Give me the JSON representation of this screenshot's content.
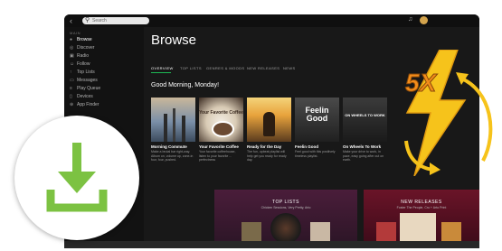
{
  "topbar": {
    "back_icon": "chevron-left-icon",
    "search_placeholder": "Search"
  },
  "sidebar": {
    "heading": "MAIN",
    "items": [
      {
        "label": "Browse",
        "icon": "browse-icon"
      },
      {
        "label": "Discover",
        "icon": "discover-icon"
      },
      {
        "label": "Radio",
        "icon": "radio-icon"
      },
      {
        "label": "Follow",
        "icon": "follow-icon"
      },
      {
        "label": "Top Lists",
        "icon": "top-lists-icon"
      },
      {
        "label": "Messages",
        "icon": "messages-icon"
      },
      {
        "label": "Play Queue",
        "icon": "play-queue-icon"
      },
      {
        "label": "Devices",
        "icon": "devices-icon"
      },
      {
        "label": "App Finder",
        "icon": "app-finder-icon"
      }
    ]
  },
  "main": {
    "title": "Browse",
    "tabs": [
      "OVERVIEW",
      "TOP LISTS",
      "GENRES & MOODS",
      "NEW RELEASES",
      "NEWS"
    ],
    "greeting": "Good Morning, Monday!",
    "cards": [
      {
        "title": "Morning Commute",
        "desc": "Make a brutal bar right-way. Album on, volume up, zone-in four, four, pushed.",
        "art_text": ""
      },
      {
        "title": "Your Favorite Coffee",
        "desc": "Your favorite coffeehouse, listen to your favorite ... perfectness",
        "art_text": "Your Favorite Coffee"
      },
      {
        "title": "Ready for the Day",
        "desc": "The fun, upbeat playlist will help get you ready for ready day.",
        "art_text": ""
      },
      {
        "title": "Feelin Good",
        "desc": "Feel good with this positively timeless playlist.",
        "art_text": "Feelin Good"
      },
      {
        "title": "On Wheels To Work",
        "desc": "Make your drive to work, in pace, easy going after out on earth.",
        "art_text": "ON WHEELS TO WORK"
      }
    ],
    "panels": [
      {
        "title": "TOP LISTS",
        "sub": "Chicken Sessions, Very Pretty, Arto"
      },
      {
        "title": "NEW RELEASES",
        "sub": "Foster The People, Cro + Arto Print"
      }
    ]
  },
  "promo": {
    "badge": "5X",
    "download_icon": "download-icon"
  },
  "colors": {
    "accent": "#1db954",
    "bolt": "#f6c31b",
    "download_green": "#7cc242"
  }
}
